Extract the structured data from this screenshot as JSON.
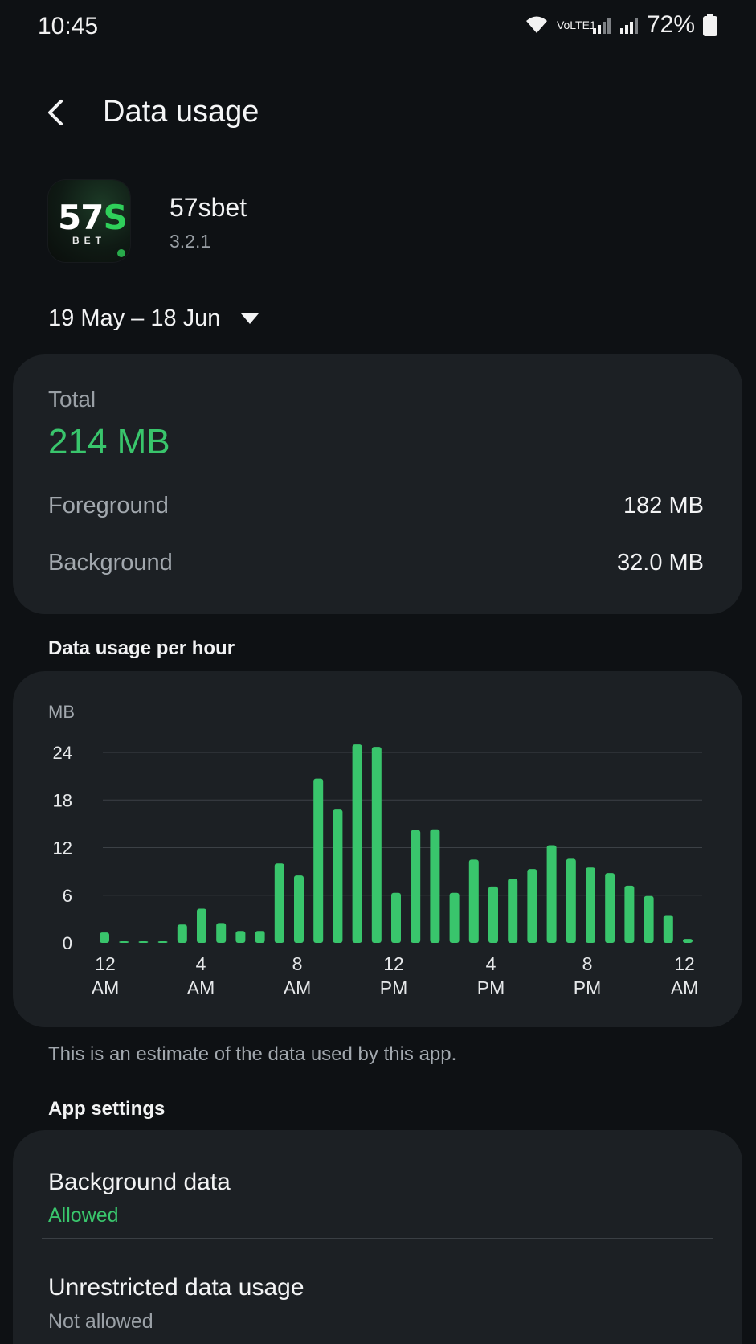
{
  "status_bar": {
    "time": "10:45",
    "battery_percent": "72%",
    "network_label": "VoLTE1",
    "icons": [
      "wifi-icon",
      "signal-icon",
      "signal-icon",
      "battery-icon"
    ]
  },
  "header": {
    "title": "Data usage",
    "back_icon": "back-chevron-icon"
  },
  "app": {
    "name": "57sbet",
    "version": "3.2.1",
    "icon_text_main": "57S",
    "icon_text_sub": "BET"
  },
  "date_range": {
    "label": "19 May – 18 Jun"
  },
  "totals": {
    "total_label": "Total",
    "total_value": "214 MB",
    "foreground_label": "Foreground",
    "foreground_value": "182 MB",
    "background_label": "Background",
    "background_value": "32.0 MB"
  },
  "chart_section": {
    "title": "Data usage per hour"
  },
  "chart_data": {
    "type": "bar",
    "ylabel": "MB",
    "ylim": [
      0,
      24
    ],
    "y_ticks": [
      0,
      6,
      12,
      18,
      24
    ],
    "x_ticks": [
      {
        "top": "12",
        "bottom": "AM"
      },
      {
        "top": "4",
        "bottom": "AM"
      },
      {
        "top": "8",
        "bottom": "AM"
      },
      {
        "top": "12",
        "bottom": "PM"
      },
      {
        "top": "4",
        "bottom": "PM"
      },
      {
        "top": "8",
        "bottom": "PM"
      },
      {
        "top": "12",
        "bottom": "AM"
      }
    ],
    "values": [
      1.3,
      0.2,
      0.1,
      0.2,
      2.3,
      4.3,
      2.5,
      1.5,
      1.5,
      10.0,
      8.5,
      20.7,
      16.8,
      25.0,
      24.7,
      6.3,
      14.2,
      14.3,
      6.3,
      10.5,
      7.1,
      8.1,
      9.3,
      12.3,
      10.6,
      9.5,
      8.8,
      7.2,
      5.9,
      3.5,
      0.5
    ],
    "colors": {
      "bar": "#39c56c",
      "grid": "#3c4146"
    }
  },
  "footnote": "This is an estimate of the data used by this app.",
  "app_settings": {
    "section_title": "App settings",
    "items": [
      {
        "title": "Background data",
        "subtitle": "Allowed",
        "subtitle_color": "#39c56c"
      },
      {
        "title": "Unrestricted data usage",
        "subtitle": "Not allowed",
        "subtitle_color": "#9aa0a6"
      }
    ]
  },
  "colors": {
    "background": "#0e1114",
    "card": "#1c2024",
    "accent_green": "#39c56c"
  }
}
